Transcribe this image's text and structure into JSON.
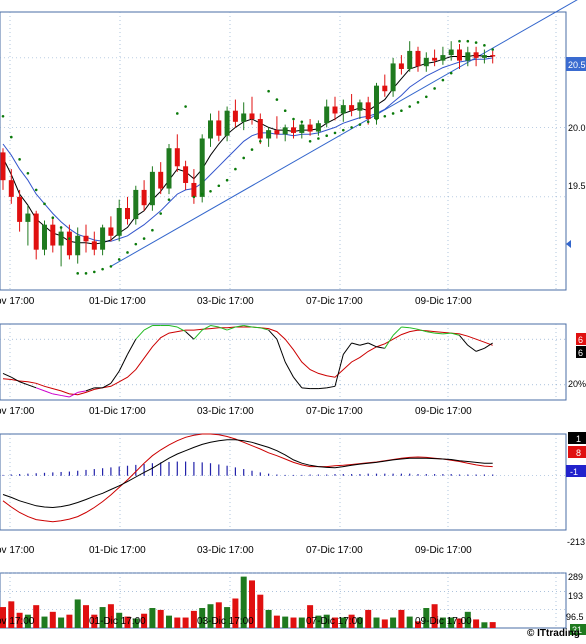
{
  "colors": {
    "up": "#1f7a1f",
    "down": "#e01010",
    "trend": "#3366cc",
    "sar": "#0a7a0a",
    "ma_black": "#000000",
    "ma_blue": "#3355cc",
    "stoch_k_up": "#22bb22",
    "stoch_k_down": "#000000",
    "stoch_k_low": "#cc00cc",
    "stoch_d": "#cc0000",
    "macd": "#000000",
    "macd_signal": "#cc0000",
    "macd_hist": "#2222aa",
    "grid": "#7a9ec8",
    "border": "#4a6da6",
    "price_badge": "#3a6bd0",
    "black_badge": "#000000",
    "red_badge": "#e01010",
    "blue_badge": "#2222cc",
    "green_badge": "#1f7a1f"
  },
  "time_labels": [
    "ov 17:00",
    "01-Dic 17:00",
    "03-Dic 17:00",
    "07-Dic 17:00",
    "09-Dic 17:00"
  ],
  "watermark": "© ITtrading",
  "chart_data": [
    {
      "type": "candlestick",
      "panel": "price",
      "y_ticks": [
        "20.5",
        "20.0",
        "19.5"
      ],
      "y_tick_values": [
        20.5,
        20.0,
        19.5
      ],
      "ylim": [
        18.83,
        20.83
      ],
      "last_price_label": "20.5",
      "grid": true,
      "ohlc": [
        [
          19.82,
          19.85,
          19.55,
          19.62
        ],
        [
          19.62,
          19.7,
          19.45,
          19.5
        ],
        [
          19.5,
          19.55,
          19.25,
          19.32
        ],
        [
          19.32,
          19.44,
          19.15,
          19.38
        ],
        [
          19.38,
          19.4,
          19.05,
          19.12
        ],
        [
          19.12,
          19.33,
          19.08,
          19.3
        ],
        [
          19.3,
          19.35,
          19.1,
          19.15
        ],
        [
          19.15,
          19.28,
          19.0,
          19.25
        ],
        [
          19.25,
          19.3,
          19.05,
          19.08
        ],
        [
          19.08,
          19.28,
          19.02,
          19.22
        ],
        [
          19.22,
          19.3,
          19.1,
          19.18
        ],
        [
          19.18,
          19.25,
          19.08,
          19.12
        ],
        [
          19.12,
          19.3,
          19.08,
          19.28
        ],
        [
          19.28,
          19.36,
          19.18,
          19.22
        ],
        [
          19.22,
          19.48,
          19.18,
          19.42
        ],
        [
          19.42,
          19.5,
          19.3,
          19.34
        ],
        [
          19.34,
          19.58,
          19.3,
          19.55
        ],
        [
          19.55,
          19.62,
          19.4,
          19.44
        ],
        [
          19.44,
          19.72,
          19.4,
          19.68
        ],
        [
          19.68,
          19.75,
          19.52,
          19.56
        ],
        [
          19.56,
          19.88,
          19.52,
          19.85
        ],
        [
          19.85,
          19.95,
          19.68,
          19.72
        ],
        [
          19.72,
          19.76,
          19.55,
          19.6
        ],
        [
          19.6,
          19.7,
          19.45,
          19.5
        ],
        [
          19.5,
          19.95,
          19.46,
          19.92
        ],
        [
          19.92,
          20.1,
          19.86,
          20.05
        ],
        [
          20.05,
          20.12,
          19.9,
          19.94
        ],
        [
          19.94,
          20.15,
          19.9,
          20.12
        ],
        [
          20.12,
          20.2,
          20.0,
          20.04
        ],
        [
          20.04,
          20.18,
          19.98,
          20.1
        ],
        [
          20.1,
          20.22,
          20.02,
          20.06
        ],
        [
          20.06,
          20.1,
          19.88,
          19.92
        ],
        [
          19.92,
          20.0,
          19.86,
          19.98
        ],
        [
          19.98,
          20.08,
          19.92,
          19.95
        ],
        [
          19.95,
          20.02,
          19.9,
          20.0
        ],
        [
          20.0,
          20.05,
          19.92,
          19.96
        ],
        [
          19.96,
          20.04,
          19.92,
          20.02
        ],
        [
          20.02,
          20.06,
          19.94,
          19.97
        ],
        [
          19.97,
          20.05,
          19.94,
          20.03
        ],
        [
          20.03,
          20.2,
          20.0,
          20.15
        ],
        [
          20.15,
          20.22,
          20.05,
          20.1
        ],
        [
          20.1,
          20.2,
          20.04,
          20.16
        ],
        [
          20.16,
          20.24,
          20.08,
          20.12
        ],
        [
          20.12,
          20.2,
          20.06,
          20.18
        ],
        [
          20.18,
          20.22,
          20.02,
          20.06
        ],
        [
          20.06,
          20.32,
          20.02,
          20.3
        ],
        [
          20.3,
          20.38,
          20.22,
          20.26
        ],
        [
          20.26,
          20.5,
          20.22,
          20.46
        ],
        [
          20.46,
          20.52,
          20.38,
          20.42
        ],
        [
          20.42,
          20.62,
          20.4,
          20.55
        ],
        [
          20.55,
          20.58,
          20.4,
          20.44
        ],
        [
          20.44,
          20.54,
          20.4,
          20.5
        ],
        [
          20.5,
          20.56,
          20.44,
          20.48
        ],
        [
          20.48,
          20.58,
          20.45,
          20.52
        ],
        [
          20.52,
          20.62,
          20.48,
          20.56
        ],
        [
          20.56,
          20.6,
          20.42,
          20.48
        ],
        [
          20.48,
          20.58,
          20.44,
          20.54
        ],
        [
          20.54,
          20.58,
          20.44,
          20.5
        ],
        [
          20.5,
          20.56,
          20.46,
          20.52
        ],
        [
          20.52,
          20.55,
          20.46,
          20.51
        ]
      ],
      "sar": [
        20.08,
        19.93,
        19.77,
        19.67,
        19.55,
        19.45,
        19.35,
        19.28,
        19.2,
        18.95,
        18.95,
        18.96,
        18.98,
        19.0,
        19.05,
        19.1,
        19.16,
        19.2,
        19.26,
        19.38,
        19.48,
        20.1,
        20.15,
        19.5,
        19.52,
        19.54,
        19.58,
        19.62,
        19.7,
        19.78,
        19.84,
        19.9,
        20.26,
        20.2,
        20.12,
        20.06,
        20.04,
        19.9,
        19.92,
        19.94,
        19.96,
        19.98,
        20.0,
        20.02,
        20.04,
        20.06,
        20.08,
        20.1,
        20.12,
        20.15,
        20.18,
        20.22,
        20.28,
        20.34,
        20.39,
        20.62,
        20.62,
        20.61,
        20.59,
        20.56
      ],
      "ma_fast": [
        19.78,
        19.66,
        19.52,
        19.44,
        19.34,
        19.29,
        19.24,
        19.22,
        19.18,
        19.17,
        19.17,
        19.16,
        19.17,
        19.19,
        19.24,
        19.28,
        19.36,
        19.4,
        19.48,
        19.54,
        19.62,
        19.7,
        19.68,
        19.63,
        19.7,
        19.8,
        19.88,
        19.95,
        20.0,
        20.04,
        20.06,
        20.03,
        20.0,
        19.98,
        19.98,
        19.97,
        19.98,
        19.98,
        19.99,
        20.03,
        20.06,
        20.1,
        20.12,
        20.14,
        20.12,
        20.16,
        20.2,
        20.28,
        20.35,
        20.42,
        20.44,
        20.46,
        20.47,
        20.49,
        20.51,
        20.51,
        20.51,
        20.52,
        20.51,
        20.51
      ],
      "ma_slow": [
        19.88,
        19.8,
        19.7,
        19.62,
        19.52,
        19.45,
        19.38,
        19.32,
        19.27,
        19.23,
        19.21,
        19.19,
        19.18,
        19.18,
        19.2,
        19.22,
        19.26,
        19.3,
        19.35,
        19.4,
        19.46,
        19.52,
        19.55,
        19.56,
        19.6,
        19.66,
        19.72,
        19.78,
        19.84,
        19.9,
        19.94,
        19.96,
        19.96,
        19.95,
        19.95,
        19.94,
        19.95,
        19.95,
        19.96,
        19.98,
        20.0,
        20.03,
        20.05,
        20.07,
        20.08,
        20.1,
        20.13,
        20.18,
        20.23,
        20.29,
        20.33,
        20.37,
        20.4,
        20.43,
        20.45,
        20.47,
        20.48,
        20.49,
        20.49,
        20.5
      ],
      "trendline": [
        [
          13,
          19.0
        ],
        [
          59,
          20.5
        ],
        [
          71,
          20.98
        ]
      ]
    },
    {
      "type": "line",
      "panel": "stochastic",
      "y_ticks": [
        "6",
        "6",
        "20%"
      ],
      "y_tick_values": [
        90,
        80,
        20
      ],
      "ylim": [
        0,
        100
      ],
      "series": [
        {
          "key": "k",
          "values": [
            35,
            30,
            24,
            20,
            16,
            12,
            8,
            6,
            4,
            10,
            12,
            16,
            16,
            22,
            38,
            60,
            80,
            92,
            98,
            98,
            98,
            96,
            90,
            80,
            92,
            98,
            96,
            92,
            96,
            98,
            96,
            95,
            92,
            80,
            50,
            30,
            16,
            15,
            15,
            16,
            18,
            60,
            75,
            72,
            75,
            70,
            68,
            85,
            96,
            95,
            93,
            90,
            88,
            87,
            88,
            85,
            72,
            64,
            68,
            75
          ]
        },
        {
          "key": "d",
          "values": [
            28,
            27,
            25,
            24,
            22,
            18,
            15,
            12,
            8,
            7,
            10,
            14,
            16,
            18,
            24,
            30,
            40,
            55,
            70,
            82,
            88,
            90,
            92,
            92,
            93,
            94,
            95,
            95,
            96,
            96,
            96,
            95,
            94,
            90,
            80,
            66,
            50,
            40,
            35,
            32,
            30,
            40,
            50,
            56,
            64,
            70,
            74,
            80,
            86,
            90,
            92,
            91,
            90,
            89,
            88,
            87,
            84,
            80,
            76,
            72
          ]
        }
      ]
    },
    {
      "type": "line+bar",
      "panel": "macd",
      "y_ticks": [
        "1",
        "8",
        "-1",
        "-213"
      ],
      "badge_values": [
        1,
        8,
        -1
      ],
      "ylim": [
        -1.3,
        1.0
      ],
      "macd": [
        -0.45,
        -0.52,
        -0.6,
        -0.66,
        -0.72,
        -0.75,
        -0.76,
        -0.74,
        -0.7,
        -0.64,
        -0.57,
        -0.49,
        -0.42,
        -0.33,
        -0.24,
        -0.14,
        -0.03,
        0.08,
        0.18,
        0.3,
        0.42,
        0.52,
        0.6,
        0.68,
        0.75,
        0.8,
        0.84,
        0.86,
        0.86,
        0.84,
        0.8,
        0.74,
        0.68,
        0.6,
        0.5,
        0.38,
        0.3,
        0.25,
        0.22,
        0.2,
        0.19,
        0.22,
        0.25,
        0.28,
        0.3,
        0.32,
        0.35,
        0.38,
        0.4,
        0.42,
        0.42,
        0.42,
        0.41,
        0.4,
        0.39,
        0.36,
        0.34,
        0.32,
        0.3,
        0.3
      ],
      "signal": [
        -0.6,
        -0.75,
        -0.88,
        -0.98,
        -1.05,
        -1.08,
        -1.1,
        -1.08,
        -1.04,
        -0.98,
        -0.88,
        -0.76,
        -0.62,
        -0.46,
        -0.28,
        -0.1,
        0.1,
        0.3,
        0.48,
        0.62,
        0.74,
        0.84,
        0.92,
        0.97,
        1.0,
        1.0,
        0.98,
        0.94,
        0.88,
        0.8,
        0.72,
        0.64,
        0.55,
        0.48,
        0.4,
        0.32,
        0.26,
        0.22,
        0.22,
        0.22,
        0.24,
        0.25,
        0.27,
        0.29,
        0.31,
        0.33,
        0.36,
        0.39,
        0.42,
        0.44,
        0.45,
        0.44,
        0.42,
        0.4,
        0.37,
        0.34,
        0.3,
        0.26,
        0.23,
        0.22
      ],
      "histogram": [
        0.02,
        0.03,
        0.04,
        0.05,
        0.06,
        0.07,
        0.08,
        0.09,
        0.1,
        0.12,
        0.14,
        0.16,
        0.18,
        0.2,
        0.22,
        0.24,
        0.26,
        0.28,
        0.3,
        0.32,
        0.33,
        0.34,
        0.34,
        0.33,
        0.32,
        0.3,
        0.27,
        0.24,
        0.2,
        0.16,
        0.12,
        0.08,
        0.05,
        0.03,
        0.02,
        0.02,
        0.02,
        0.03,
        0.03,
        0.03,
        0.04,
        0.04,
        0.04,
        0.04,
        0.05,
        0.05,
        0.05,
        0.05,
        0.05,
        0.05,
        0.04,
        0.04,
        0.04,
        0.04,
        0.04,
        0.03,
        0.03,
        0.03,
        0.03,
        0.03
      ]
    },
    {
      "type": "bar",
      "panel": "volume",
      "y_ticks": [
        "289",
        "193",
        "96.5",
        "31"
      ],
      "y_tick_values": [
        289,
        193,
        96.5
      ],
      "ylim": [
        0,
        289
      ],
      "values": [
        110,
        140,
        80,
        70,
        120,
        60,
        85,
        55,
        70,
        150,
        120,
        70,
        110,
        125,
        80,
        60,
        50,
        75,
        105,
        95,
        65,
        55,
        55,
        90,
        105,
        125,
        135,
        110,
        155,
        270,
        250,
        175,
        95,
        65,
        60,
        55,
        55,
        120,
        65,
        70,
        55,
        55,
        70,
        55,
        95,
        55,
        45,
        55,
        95,
        60,
        35,
        105,
        125,
        55,
        55,
        50,
        85,
        45,
        30,
        31
      ]
    }
  ]
}
